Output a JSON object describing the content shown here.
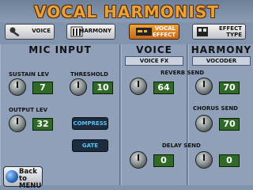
{
  "title": "VOCAL HARMONIST",
  "tabs": [
    {
      "label": "VOICE",
      "icon": "microphone-icon"
    },
    {
      "label": "HARMONY",
      "icon": "harmony-notes-icon"
    },
    {
      "label": "VOCAL\nEFFECT",
      "icon": "effect-unit-icon",
      "active": true
    },
    {
      "label": "EFFECT\nTYPE",
      "icon": "effect-type-icon"
    }
  ],
  "mic_input": {
    "title": "MIC INPUT",
    "sustain_label": "SUSTAIN LEV",
    "sustain_value": "7",
    "threshold_label": "THRESHOLD",
    "threshold_value": "10",
    "output_label": "OUTPUT LEV",
    "output_value": "32",
    "compress_label": "COMPRESS",
    "gate_label": "GATE"
  },
  "voice": {
    "title": "VOICE",
    "sub": "VOICE FX",
    "reverb_value": "64",
    "delay_value": "0"
  },
  "harmony": {
    "title": "HARMONY",
    "sub": "VOCODER",
    "reverb_value": "70",
    "chorus_value": "70",
    "delay_value": "0"
  },
  "shared": {
    "reverb_send_label": "REVERB SEND",
    "chorus_send_label": "CHORUS SEND",
    "delay_send_label": "DELAY SEND"
  },
  "back": {
    "label": "Back to\nMENU"
  },
  "colors": {
    "accent": "#e9a13a",
    "value_box": "#2f6b27",
    "button_text": "#5ec2f0"
  }
}
